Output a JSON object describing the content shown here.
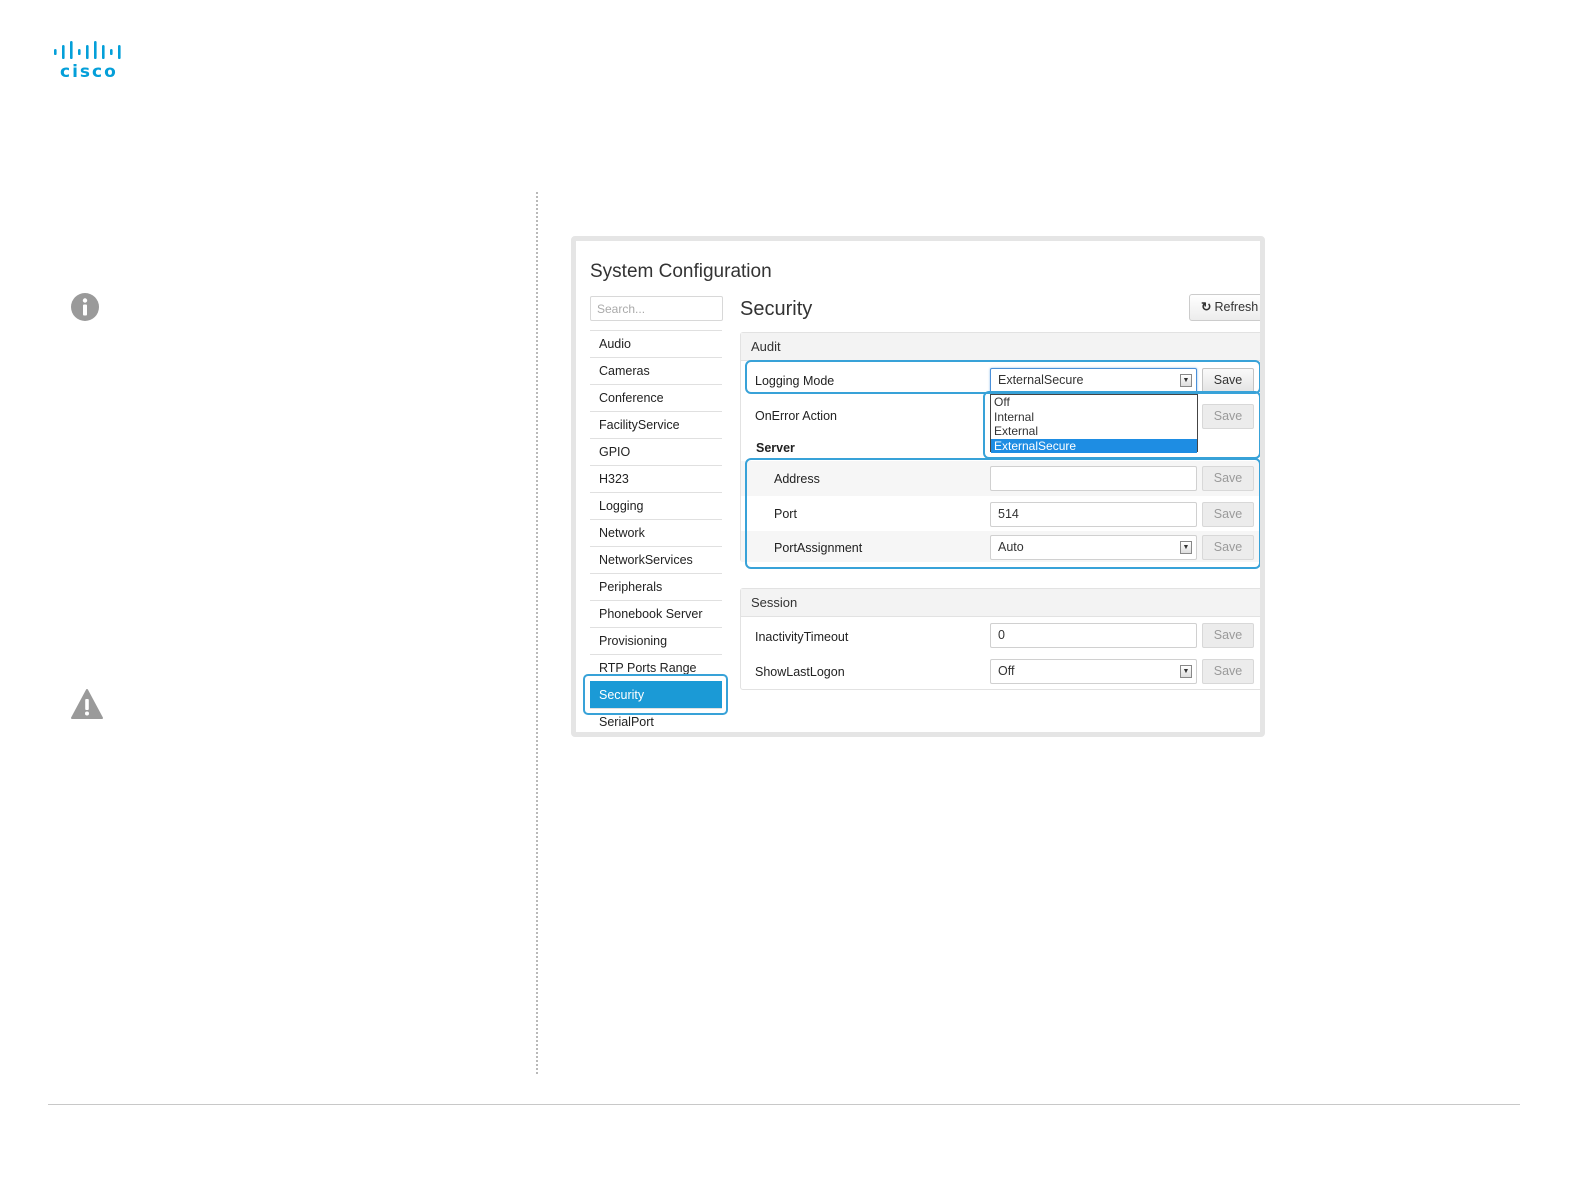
{
  "brand": {
    "logo_text": "cisco",
    "logo_color": "#049fd9"
  },
  "config": {
    "title": "System Configuration",
    "search_placeholder": "Search...",
    "section_title": "Security",
    "refresh_label": "Refresh",
    "sidebar": [
      {
        "label": "Audio"
      },
      {
        "label": "Cameras"
      },
      {
        "label": "Conference"
      },
      {
        "label": "FacilityService"
      },
      {
        "label": "GPIO"
      },
      {
        "label": "H323"
      },
      {
        "label": "Logging"
      },
      {
        "label": "Network"
      },
      {
        "label": "NetworkServices"
      },
      {
        "label": "Peripherals"
      },
      {
        "label": "Phonebook Server"
      },
      {
        "label": "Provisioning"
      },
      {
        "label": "RTP Ports Range"
      },
      {
        "label": "Security",
        "active": true
      },
      {
        "label": "SerialPort"
      }
    ],
    "audit": {
      "heading": "Audit",
      "logging_mode": {
        "label": "Logging Mode",
        "value": "ExternalSecure",
        "save": "Save"
      },
      "dropdown_options": [
        "Off",
        "Internal",
        "External",
        "ExternalSecure"
      ],
      "on_error": {
        "label": "OnError Action",
        "save": "Save"
      },
      "server": {
        "heading": "Server",
        "address": {
          "label": "Address",
          "value": "",
          "save": "Save"
        },
        "port": {
          "label": "Port",
          "value": "514",
          "save": "Save"
        },
        "port_assignment": {
          "label": "PortAssignment",
          "value": "Auto",
          "save": "Save"
        }
      }
    },
    "session": {
      "heading": "Session",
      "inactivity": {
        "label": "InactivityTimeout",
        "value": "0",
        "save": "Save"
      },
      "show_last_logon": {
        "label": "ShowLastLogon",
        "value": "Off",
        "save": "Save"
      }
    }
  },
  "colors": {
    "accent": "#1b9ad6",
    "highlight": "#38a2d8",
    "selected_option": "#1e8de3"
  }
}
